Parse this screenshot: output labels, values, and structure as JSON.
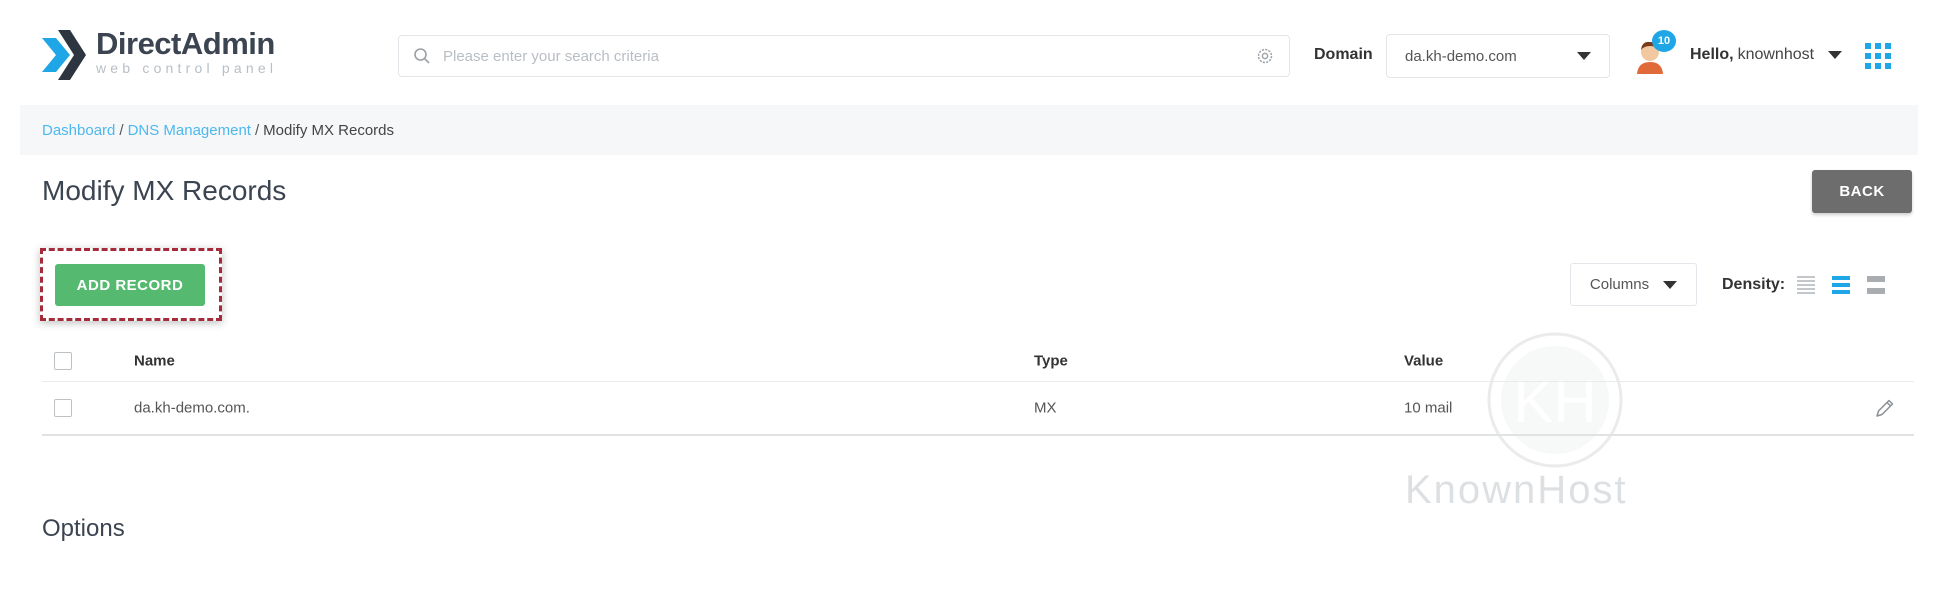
{
  "header": {
    "logo_name_first": "Direct",
    "logo_name_second": "Admin",
    "logo_sub": "web control panel",
    "search_placeholder": "Please enter your search criteria",
    "domain_label": "Domain",
    "domain_value": "da.kh-demo.com",
    "notification_count": "10",
    "hello_label": "Hello,",
    "username": "knownhost"
  },
  "breadcrumb": {
    "items": [
      "Dashboard",
      "DNS Management"
    ],
    "current": "Modify MX Records"
  },
  "page": {
    "title": "Modify MX Records",
    "back_label": "BACK",
    "add_record_label": "ADD RECORD",
    "columns_label": "Columns",
    "density_label": "Density:",
    "options_title": "Options"
  },
  "table": {
    "headers": {
      "name": "Name",
      "type": "Type",
      "value": "Value"
    },
    "rows": [
      {
        "name": "da.kh-demo.com.",
        "type": "MX",
        "value": "10 mail"
      }
    ]
  },
  "watermark_text": "KnownHost",
  "colors": {
    "accent": "#1fa6e6",
    "add_button": "#55b96f",
    "back_button": "#6d6d6d",
    "highlight_border": "#a52a3a"
  }
}
